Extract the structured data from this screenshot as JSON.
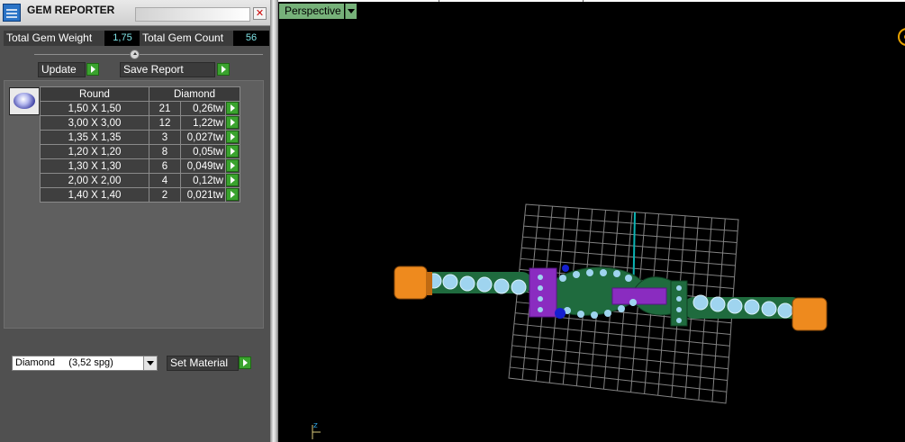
{
  "window": {
    "title": "GEM REPORTER",
    "close_glyph": "✕"
  },
  "stats": {
    "weight_label": "Total Gem Weight",
    "weight_value": "1,75",
    "count_label": "Total Gem Count",
    "count_value": "56"
  },
  "buttons": {
    "update": "Update",
    "save_report": "Save Report",
    "set_material": "Set Material"
  },
  "table": {
    "headers": [
      "Round",
      "Diamond"
    ],
    "rows": [
      {
        "size": "1,50 X 1,50",
        "count": "21",
        "weight": "0,26tw"
      },
      {
        "size": "3,00 X 3,00",
        "count": "12",
        "weight": "1,22tw"
      },
      {
        "size": "1,35 X 1,35",
        "count": "3",
        "weight": "0,027tw"
      },
      {
        "size": "1,20 X 1,20",
        "count": "8",
        "weight": "0,05tw"
      },
      {
        "size": "1,30 X 1,30",
        "count": "6",
        "weight": "0,049tw"
      },
      {
        "size": "2,00 X 2,00",
        "count": "4",
        "weight": "0,12tw"
      },
      {
        "size": "1,40 X 1,40",
        "count": "2",
        "weight": "0,021tw"
      }
    ]
  },
  "material": {
    "selected": "Diamond     (3,52 spg)"
  },
  "viewport": {
    "label": "Perspective",
    "axis_glyph": "z"
  },
  "colors": {
    "panel_bg": "#505050",
    "value_text": "#7fe3e6",
    "go_button": "#3aa32e",
    "viewport_label_bg": "#76b179",
    "viewport_bg": "#000000",
    "grid": "#9a9a9a",
    "gold_cap": "#ee8a1e",
    "band_green": "#1f6b3e",
    "purple_part": "#8a2cc0",
    "stone": "#9fd4ef"
  },
  "icons": [
    "gem-reporter-app-icon",
    "close-icon",
    "slider-knob-icon",
    "play-arrow-icon",
    "dropdown-arrow-icon",
    "round-gem-icon",
    "axis-gizmo-icon"
  ]
}
